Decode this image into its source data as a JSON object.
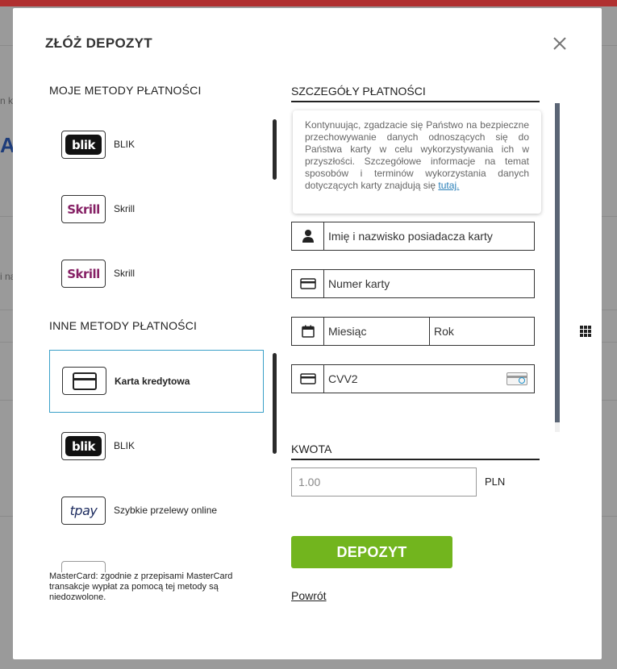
{
  "modal": {
    "title": "ZŁÓŻ DEPOZYT",
    "close_icon": "close-icon"
  },
  "background": {
    "frag1": "n kr",
    "frag2": "A",
    "frag3": "i na"
  },
  "my_methods": {
    "title": "MOJE METODY PŁATNOŚCI",
    "items": [
      {
        "label": "BLIK",
        "logo": "blik"
      },
      {
        "label": "Skrill",
        "logo": "Skrill"
      },
      {
        "label": "Skrill",
        "logo": "Skrill"
      }
    ]
  },
  "other_methods": {
    "title": "INNE METODY PŁATNOŚCI",
    "items": [
      {
        "label": "Karta kredytowa",
        "logo": "credit-card-icon",
        "selected": true
      },
      {
        "label": "BLIK",
        "logo": "blik"
      },
      {
        "label": "Szybkie przelewy online",
        "logo": "tpay"
      }
    ]
  },
  "mastercard_note": "MasterCard: zgodnie z przepisami MasterCard transakcje wypłat za pomocą tej metody są niedozwolone.",
  "payment_details": {
    "title": "SZCZEGÓŁY PŁATNOŚCI",
    "info_text": "Kontynuując, zgadzacie się Państwo na bezpieczne przechowywanie danych odnoszących się do Państwa karty w celu wykorzystywania ich w przyszłości. Szczegółowe informacje na temat sposobów i terminów wykorzystania danych dotyczących karty znajdują się ",
    "info_link": "tutaj.",
    "fields": {
      "cardholder_placeholder": "Imię i nazwisko posiadacza karty",
      "card_number_placeholder": "Numer karty",
      "month_placeholder": "Miesiąc",
      "year_placeholder": "Rok",
      "cvv_placeholder": "CVV2"
    }
  },
  "amount": {
    "title": "KWOTA",
    "placeholder": "1.00",
    "currency": "PLN"
  },
  "actions": {
    "deposit_label": "DEPOZYT",
    "back_label": "Powrót"
  },
  "colors": {
    "accent_green": "#72b51e",
    "selected_border": "#3aa0c8",
    "link": "#2a7fb8"
  }
}
